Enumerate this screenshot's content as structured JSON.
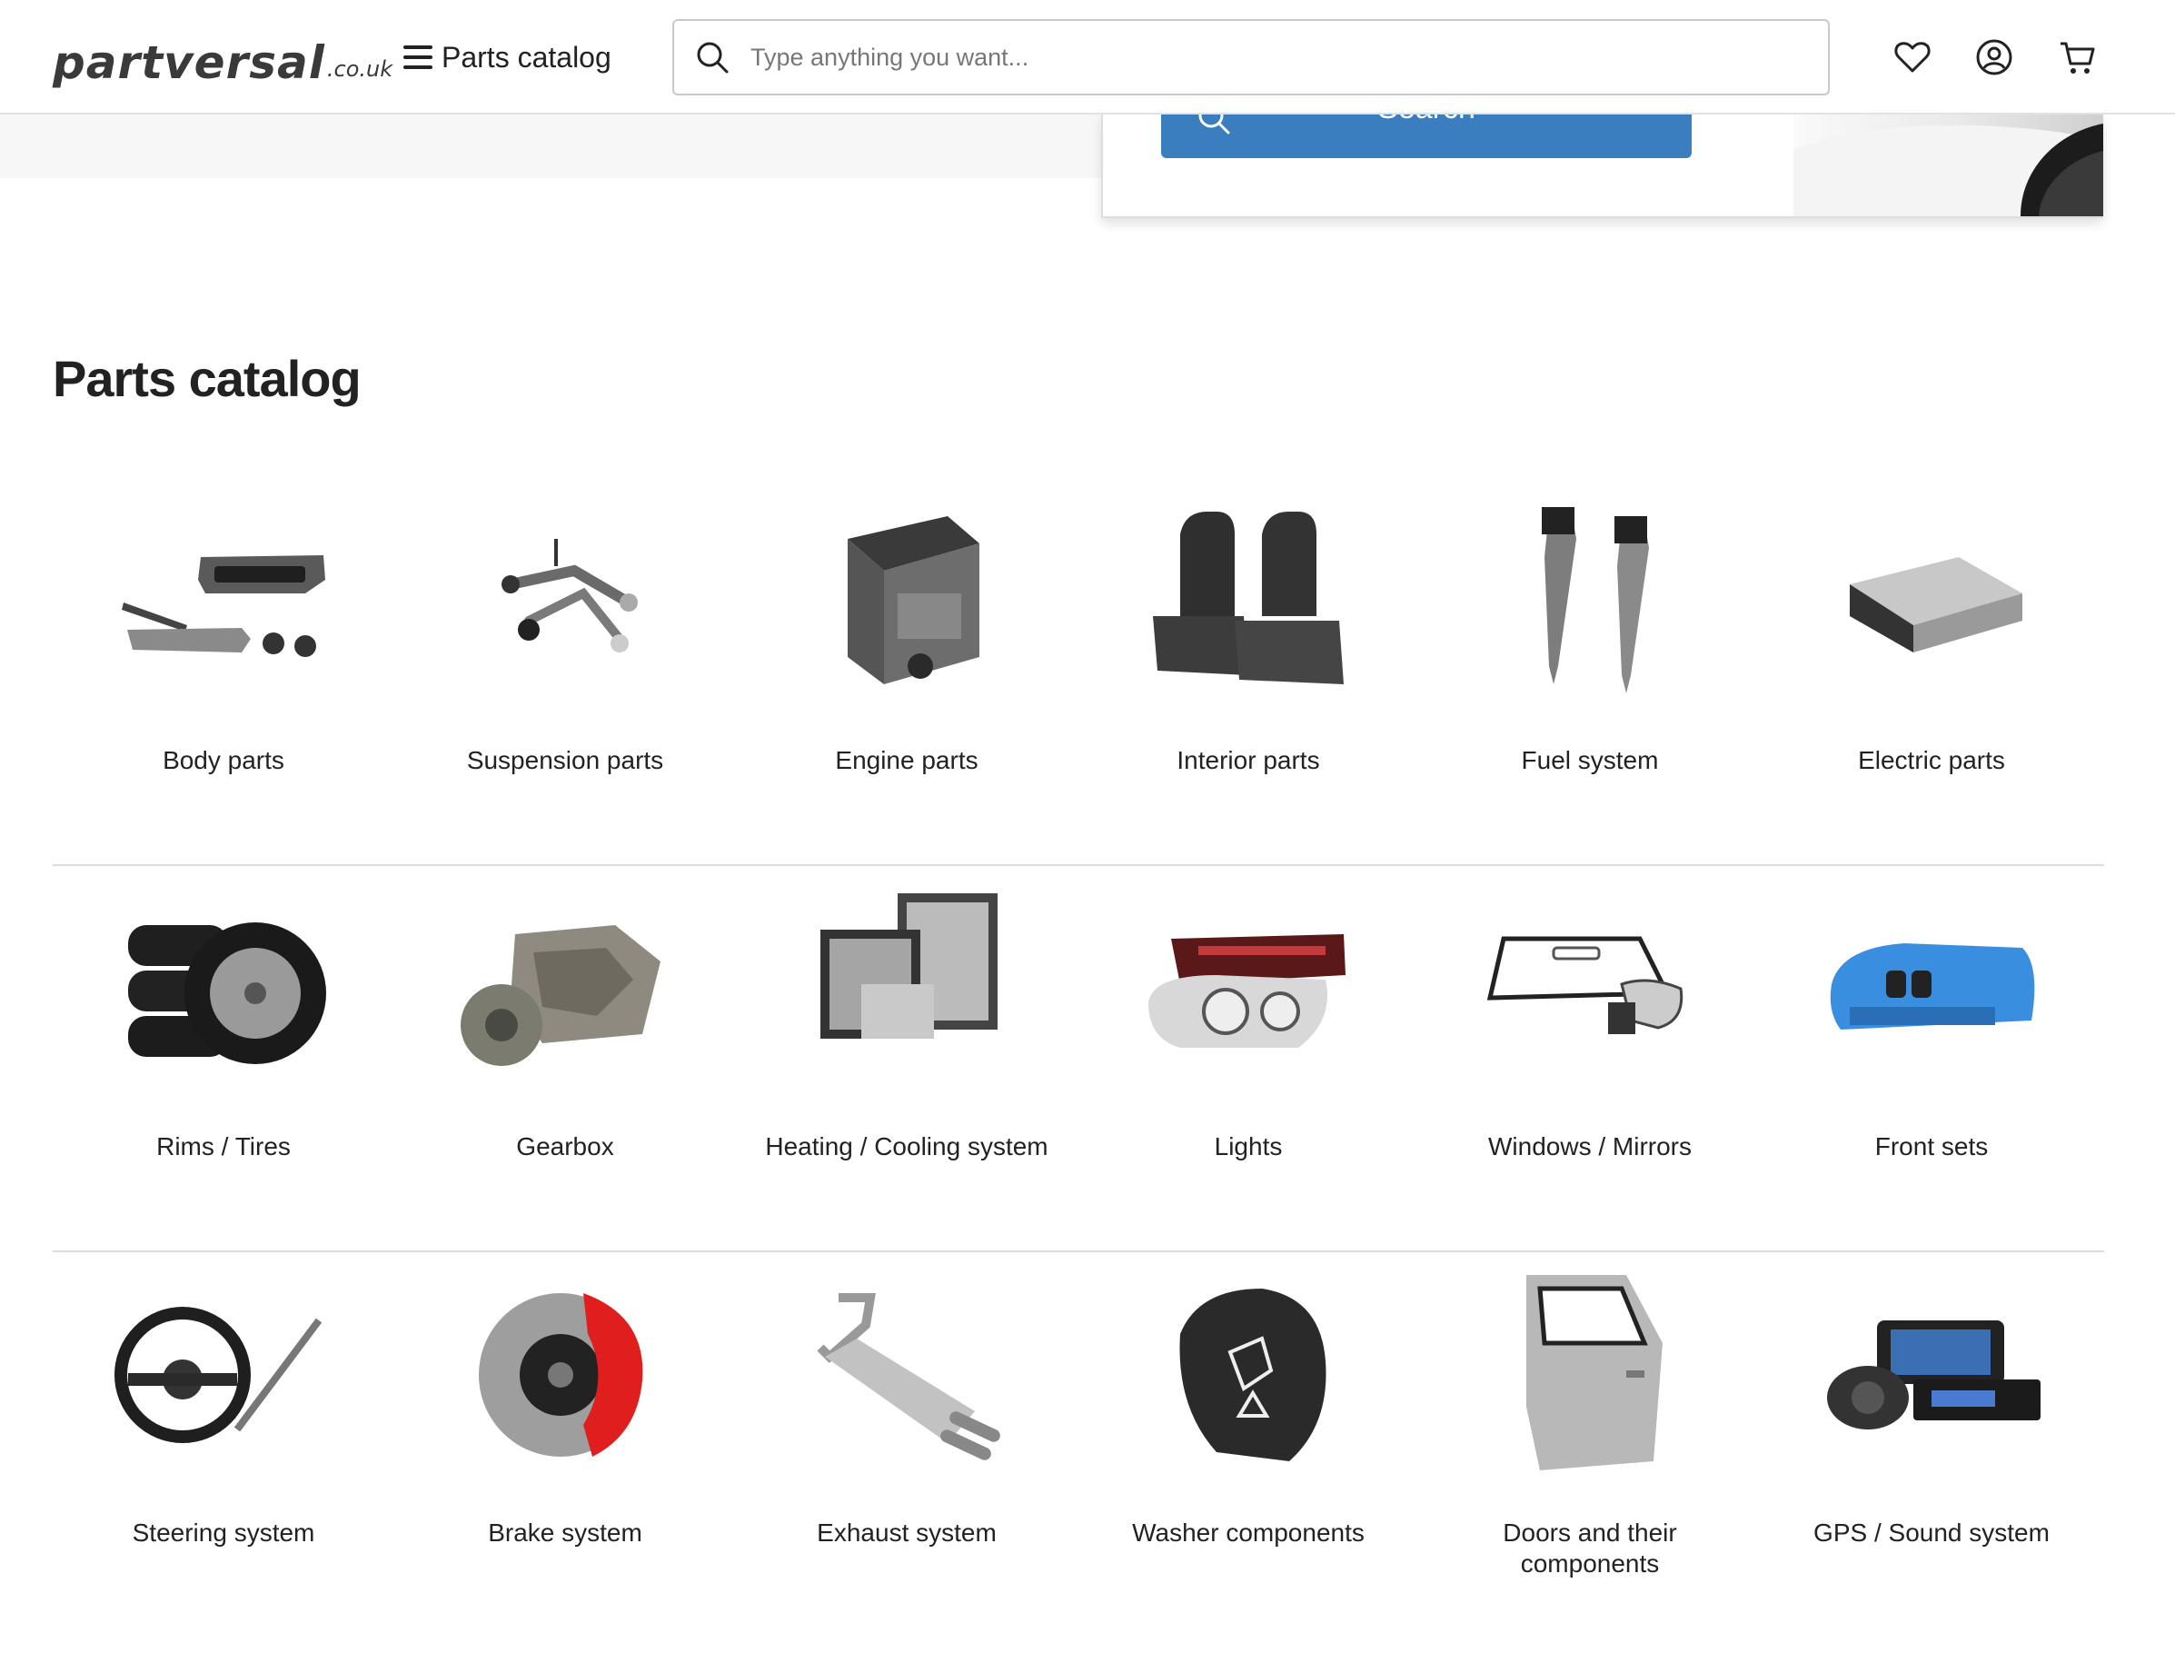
{
  "header": {
    "logo_text": "partversal",
    "logo_suffix": ".co.uk",
    "catalog_label": "Parts catalog",
    "search_placeholder": "Type anything you want..."
  },
  "hero": {
    "search_button_label": "Search"
  },
  "catalog": {
    "title": "Parts catalog",
    "rows": [
      [
        {
          "label": "Body parts",
          "icon": "body-parts"
        },
        {
          "label": "Suspension parts",
          "icon": "suspension-parts"
        },
        {
          "label": "Engine parts",
          "icon": "engine-parts"
        },
        {
          "label": "Interior parts",
          "icon": "interior-parts"
        },
        {
          "label": "Fuel system",
          "icon": "fuel-system"
        },
        {
          "label": "Electric parts",
          "icon": "electric-parts"
        }
      ],
      [
        {
          "label": "Rims / Tires",
          "icon": "rims-tires"
        },
        {
          "label": "Gearbox",
          "icon": "gearbox"
        },
        {
          "label": "Heating / Cooling system",
          "icon": "heating-cooling"
        },
        {
          "label": "Lights",
          "icon": "lights"
        },
        {
          "label": "Windows / Mirrors",
          "icon": "windows-mirrors"
        },
        {
          "label": "Front sets",
          "icon": "front-sets"
        }
      ],
      [
        {
          "label": "Steering system",
          "icon": "steering-system"
        },
        {
          "label": "Brake system",
          "icon": "brake-system"
        },
        {
          "label": "Exhaust system",
          "icon": "exhaust-system"
        },
        {
          "label": "Washer components",
          "icon": "washer-components"
        },
        {
          "label": "Doors and their components",
          "icon": "doors"
        },
        {
          "label": "GPS / Sound system",
          "icon": "gps-sound"
        }
      ]
    ]
  }
}
